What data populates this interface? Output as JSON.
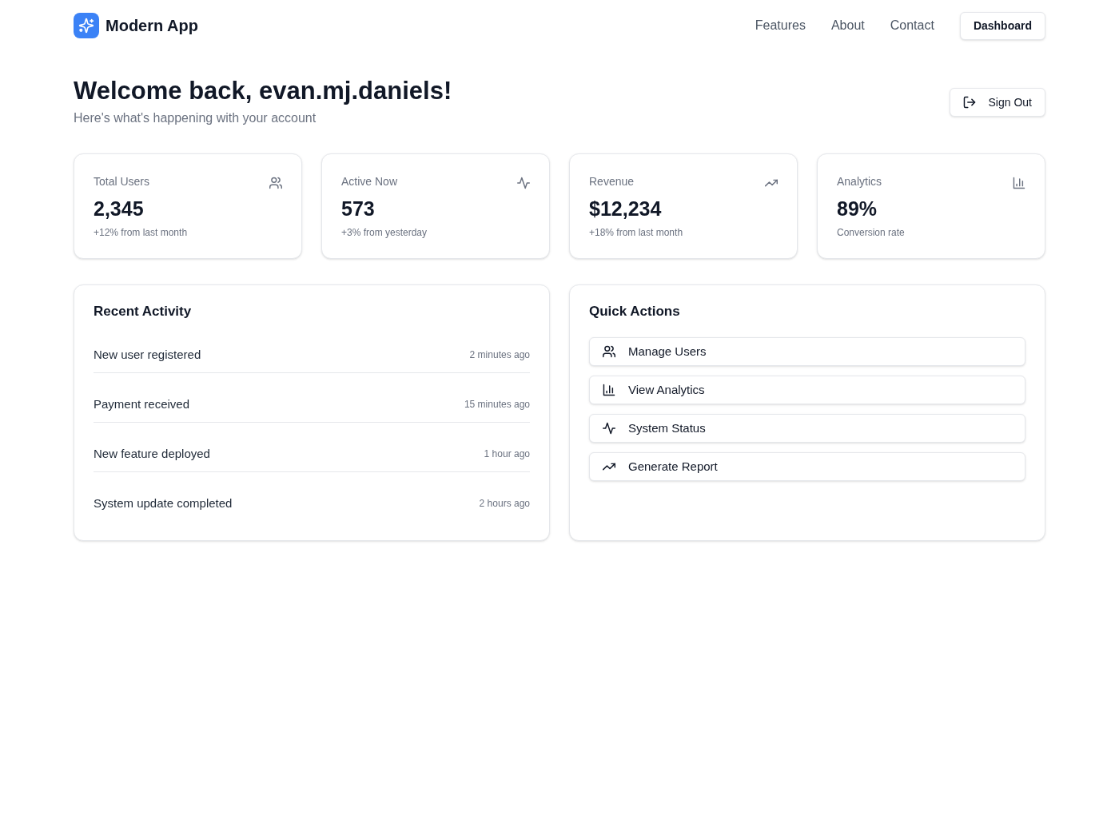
{
  "header": {
    "brand": "Modern App",
    "nav_links": [
      "Features",
      "About",
      "Contact"
    ],
    "nav_button": "Dashboard"
  },
  "welcome": {
    "title": "Welcome back, evan.mj.daniels!",
    "subtitle": "Here's what's happening with your account",
    "sign_out": "Sign Out"
  },
  "stats": [
    {
      "label": "Total Users",
      "value": "2,345",
      "note": "+12% from last month"
    },
    {
      "label": "Active Now",
      "value": "573",
      "note": "+3% from yesterday"
    },
    {
      "label": "Revenue",
      "value": "$12,234",
      "note": "+18% from last month"
    },
    {
      "label": "Analytics",
      "value": "89%",
      "note": "Conversion rate"
    }
  ],
  "recent_activity": {
    "title": "Recent Activity",
    "items": [
      {
        "text": "New user registered",
        "time": "2 minutes ago"
      },
      {
        "text": "Payment received",
        "time": "15 minutes ago"
      },
      {
        "text": "New feature deployed",
        "time": "1 hour ago"
      },
      {
        "text": "System update completed",
        "time": "2 hours ago"
      }
    ]
  },
  "quick_actions": {
    "title": "Quick Actions",
    "actions": [
      "Manage Users",
      "View Analytics",
      "System Status",
      "Generate Report"
    ]
  }
}
